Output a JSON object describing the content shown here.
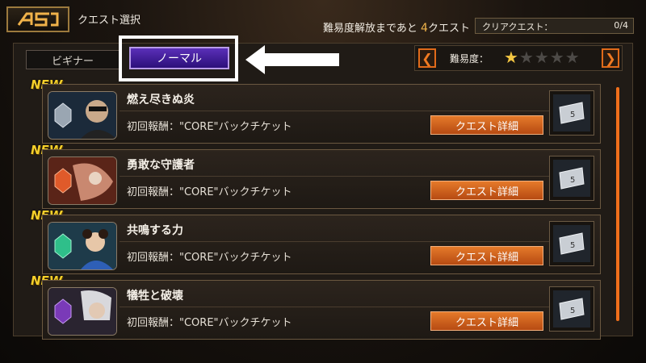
{
  "header": {
    "title": "クエスト選択",
    "unlock_prefix": "難易度解放まであと",
    "unlock_count": "4",
    "unlock_suffix": "クエスト",
    "clear_label": "クリアクエスト：",
    "clear_value": "0/4"
  },
  "tabs": [
    {
      "label": "ビギナー",
      "selected": false
    },
    {
      "label": "ノーマル",
      "selected": true
    }
  ],
  "difficulty": {
    "label": "難易度：",
    "stars_filled": 1,
    "stars_total": 5,
    "prev_icon": "chevron-left-icon",
    "next_icon": "chevron-right-icon"
  },
  "quests": [
    {
      "new": "NEW",
      "name": "燃え尽きぬ炎",
      "reward": "初回報酬：\"CORE\"バックチケット",
      "button": "クエスト詳細",
      "ticket_num": "5"
    },
    {
      "new": "NEW",
      "name": "勇敢な守護者",
      "reward": "初回報酬：\"CORE\"バックチケット",
      "button": "クエスト詳細",
      "ticket_num": "5"
    },
    {
      "new": "NEW",
      "name": "共鳴する力",
      "reward": "初回報酬：\"CORE\"バックチケット",
      "button": "クエスト詳細",
      "ticket_num": "5"
    },
    {
      "new": "NEW",
      "name": "犠牲と破壊",
      "reward": "初回報酬：\"CORE\"バックチケット",
      "button": "クエスト詳細",
      "ticket_num": "5"
    }
  ],
  "colors": {
    "accent_orange": "#e06a1a",
    "tab_selected": "#3d1b96",
    "star_on": "#f3c642",
    "new_badge": "#f5cf2a"
  }
}
